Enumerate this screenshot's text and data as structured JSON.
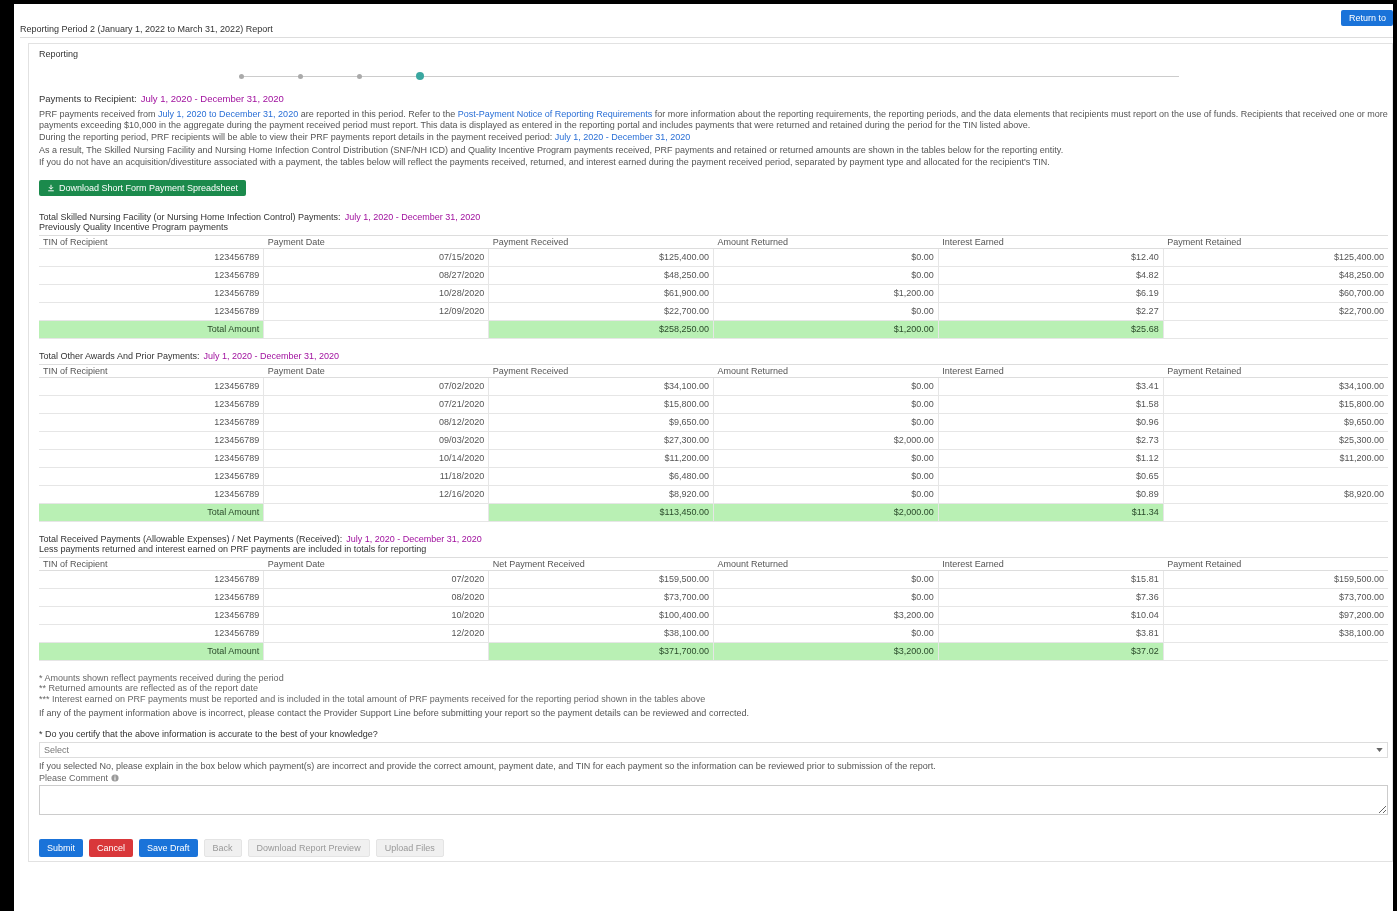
{
  "header": {
    "title": "Reporting Period 2 (January 1, 2022 to March 31, 2022) Report",
    "action_button": "Return to"
  },
  "section": {
    "label": "Reporting",
    "steps": [
      {
        "selected": false
      },
      {
        "selected": false
      },
      {
        "selected": false
      },
      {
        "selected": true
      }
    ],
    "heading": "Payments to Recipient:",
    "heading_period": "July 1, 2020 - December 31, 2020",
    "paragraphs": [
      [
        {
          "text": "PRF payments received from "
        },
        {
          "text": "July 1, 2020 to December 31, 2020",
          "link": true
        },
        {
          "text": " are reported in this period. Refer to the "
        },
        {
          "text": "Post-Payment Notice of Reporting Requirements",
          "link": true
        },
        {
          "text": " for more information about the reporting requirements, the reporting periods, and the data elements that recipients must report on the use of funds. Recipients that received one or more payments exceeding $10,000 in the aggregate during the payment received period must report. This data is displayed as entered in the reporting portal and includes payments that were returned and retained during the period for the TIN listed above."
        }
      ],
      [
        {
          "text": "During the reporting period, PRF recipients will be able to view their PRF payments report details in the payment received period: "
        },
        {
          "text": "July 1, 2020 - December 31, 2020",
          "link": true
        }
      ],
      [
        {
          "text": "As a result, The Skilled Nursing Facility and Nursing Home Infection Control Distribution (SNF/NH ICD) and Quality Incentive Program payments received, PRF payments and retained or returned amounts are shown in the tables below for the reporting entity."
        }
      ],
      [
        {
          "text": "If you do not have an acquisition/divestiture associated with a payment, the tables below will reflect the payments received, returned, and interest earned during the payment received period, separated by payment type and allocated for the recipient's TIN."
        }
      ]
    ],
    "download_button": "Download Short Form Payment Spreadsheet",
    "tables": [
      {
        "title": "Total Skilled Nursing Facility (or Nursing Home Infection Control) Payments:",
        "period": "July 1, 2020 - December 31, 2020",
        "subtitle": "Previously Quality Incentive Program payments",
        "columns": [
          "TIN of Recipient",
          "Payment Date",
          "Payment Received",
          "Amount Returned",
          "Interest Earned",
          "Payment Retained"
        ],
        "rows": [
          {
            "kind": "data",
            "cells": [
              "123456789",
              "07/15/2020",
              "$125,400.00",
              "$0.00",
              "$12.40",
              "$125,400.00"
            ]
          },
          {
            "kind": "data",
            "cells": [
              "123456789",
              "08/27/2020",
              "$48,250.00",
              "$0.00",
              "$4.82",
              "$48,250.00"
            ]
          },
          {
            "kind": "data",
            "cells": [
              "123456789",
              "10/28/2020",
              "$61,900.00",
              "$1,200.00",
              "$6.19",
              "$60,700.00"
            ]
          },
          {
            "kind": "data",
            "cells": [
              "123456789",
              "12/09/2020",
              "$22,700.00",
              "$0.00",
              "$2.27",
              "$22,700.00"
            ]
          },
          {
            "kind": "total",
            "cells": [
              "Total Amount",
              "",
              "$258,250.00",
              "$1,200.00",
              "$25.68",
              ""
            ]
          }
        ]
      },
      {
        "title": "Total Other Awards And Prior Payments:",
        "period": "July 1, 2020 - December 31, 2020",
        "columns": [
          "TIN of Recipient",
          "Payment Date",
          "Payment Received",
          "Amount Returned",
          "Interest Earned",
          "Payment Retained"
        ],
        "rows": [
          {
            "kind": "data",
            "cells": [
              "123456789",
              "07/02/2020",
              "$34,100.00",
              "$0.00",
              "$3.41",
              "$34,100.00"
            ]
          },
          {
            "kind": "data",
            "cells": [
              "123456789",
              "07/21/2020",
              "$15,800.00",
              "$0.00",
              "$1.58",
              "$15,800.00"
            ]
          },
          {
            "kind": "data",
            "cells": [
              "123456789",
              "08/12/2020",
              "$9,650.00",
              "$0.00",
              "$0.96",
              "$9,650.00"
            ]
          },
          {
            "kind": "data",
            "cells": [
              "123456789",
              "09/03/2020",
              "$27,300.00",
              "$2,000.00",
              "$2.73",
              "$25,300.00"
            ]
          },
          {
            "kind": "data",
            "cells": [
              "123456789",
              "10/14/2020",
              "$11,200.00",
              "$0.00",
              "$1.12",
              "$11,200.00"
            ]
          },
          {
            "kind": "data",
            "cells": [
              "123456789",
              "11/18/2020",
              "$6,480.00",
              "$0.00",
              "$0.65",
              ""
            ]
          },
          {
            "kind": "data",
            "cells": [
              "123456789",
              "12/16/2020",
              "$8,920.00",
              "$0.00",
              "$0.89",
              "$8,920.00"
            ]
          },
          {
            "kind": "total",
            "cells": [
              "Total Amount",
              "",
              "$113,450.00",
              "$2,000.00",
              "$11.34",
              ""
            ]
          }
        ]
      },
      {
        "title": "Total Received Payments (Allowable Expenses) / Net Payments (Received):",
        "period": "July 1, 2020 - December 31, 2020",
        "subtitle": "Less payments returned and interest earned on PRF payments are included in totals for reporting",
        "columns": [
          "TIN of Recipient",
          "Payment Date",
          "Net Payment Received",
          "Amount Returned",
          "Interest Earned",
          "Payment Retained"
        ],
        "rows": [
          {
            "kind": "data",
            "cells": [
              "123456789",
              "07/2020",
              "$159,500.00",
              "$0.00",
              "$15.81",
              "$159,500.00"
            ]
          },
          {
            "kind": "data",
            "cells": [
              "123456789",
              "08/2020",
              "$73,700.00",
              "$0.00",
              "$7.36",
              "$73,700.00"
            ]
          },
          {
            "kind": "data",
            "cells": [
              "123456789",
              "10/2020",
              "$100,400.00",
              "$3,200.00",
              "$10.04",
              "$97,200.00"
            ]
          },
          {
            "kind": "data",
            "cells": [
              "123456789",
              "12/2020",
              "$38,100.00",
              "$0.00",
              "$3.81",
              "$38,100.00"
            ]
          },
          {
            "kind": "total",
            "cells": [
              "Total Amount",
              "",
              "$371,700.00",
              "$3,200.00",
              "$37.02",
              ""
            ]
          }
        ]
      }
    ],
    "footnotes": [
      "* Amounts shown reflect payments received during the period",
      "** Returned amounts are reflected as of the report date",
      "*** Interest earned on PRF payments must be reported and is included in the total amount of PRF payments received for the reporting period shown in the tables above"
    ],
    "note": "If any of the payment information above is incorrect, please contact the Provider Support Line before submitting your report so the payment details can be reviewed and corrected.",
    "question": "* Do you certify that the above information is accurate to the best of your knowledge?",
    "select_value": "Select",
    "comment_prompt": "If you selected No, please explain in the box below which payment(s) are incorrect and provide the correct amount, payment date, and TIN for each payment so the information can be reviewed prior to submission of the report.",
    "comment_label": "Please Comment",
    "buttons": [
      {
        "label": "Submit",
        "kind": "primary",
        "disabled": false
      },
      {
        "label": "Cancel",
        "kind": "danger",
        "disabled": false
      },
      {
        "label": "Save Draft",
        "kind": "primary",
        "disabled": false
      },
      {
        "label": "Back",
        "kind": "plain",
        "disabled": true
      },
      {
        "label": "Download Report Preview",
        "kind": "plain",
        "disabled": true
      },
      {
        "label": "Upload Files",
        "kind": "plain",
        "disabled": true
      }
    ]
  }
}
